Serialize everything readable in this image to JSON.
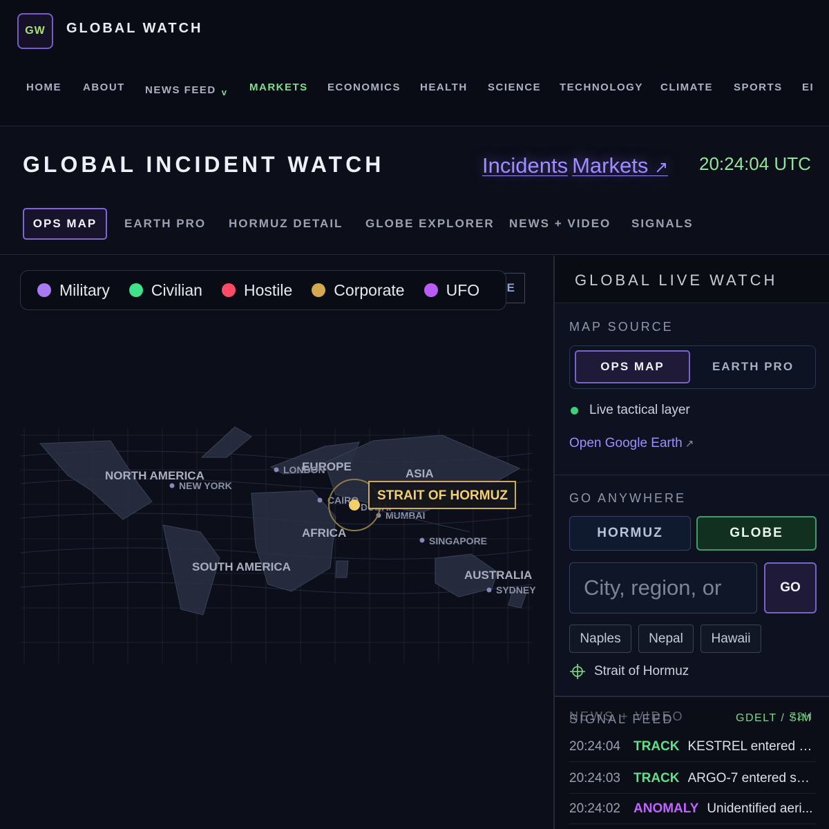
{
  "header": {
    "logo": "GW",
    "brand": "GLOBAL WATCH",
    "nav": [
      {
        "label": "HOME"
      },
      {
        "label": "ABOUT"
      },
      {
        "label": "NEWS FEED",
        "chevron": "v"
      },
      {
        "label": "MARKETS",
        "active": true
      },
      {
        "label": "ECONOMICS"
      },
      {
        "label": "HEALTH"
      },
      {
        "label": "SCIENCE"
      },
      {
        "label": "TECHNOLOGY"
      },
      {
        "label": "CLIMATE"
      },
      {
        "label": "SPORTS"
      },
      {
        "label": "EI"
      }
    ]
  },
  "titlebar": {
    "title": "GLOBAL INCIDENT WATCH",
    "link_incidents": "Incidents",
    "link_markets": "Markets",
    "link_ext": "↗",
    "clock": "20:24:04 UTC",
    "tabs": [
      "OPS MAP",
      "EARTH PRO",
      "HORMUZ DETAIL",
      "GLOBE EXPLORER",
      "NEWS + VIDEO",
      "SIGNALS"
    ]
  },
  "map": {
    "legend": [
      {
        "label": "Military",
        "color": "#a77bf3"
      },
      {
        "label": "Civilian",
        "color": "#3ee28a"
      },
      {
        "label": "Hostile",
        "color": "#ff4b66"
      },
      {
        "label": "Corporate",
        "color": "#d4a84e"
      },
      {
        "label": "UFO",
        "color": "#b95cf5"
      }
    ],
    "ghost_button": "E",
    "regions": [
      "NORTH AMERICA",
      "EUROPE",
      "ASIA",
      "AFRICA",
      "SOUTH AMERICA",
      "AUSTRALIA"
    ],
    "cities": [
      "NEW YORK",
      "LONDON",
      "CAIRO",
      "DUBAI",
      "MUMBAI",
      "SINGAPORE",
      "SYDNEY"
    ],
    "focus_label": "STRAIT OF HORMUZ"
  },
  "panel": {
    "title": "GLOBAL LIVE WATCH",
    "map_source": {
      "label": "MAP SOURCE",
      "on": "OPS MAP",
      "off": "EARTH PRO",
      "status": "Live tactical layer",
      "link": "Open Google Earth",
      "link_ext": "↗"
    },
    "go_anywhere": {
      "label": "GO ANYWHERE",
      "btn_hormuz": "HORMUZ",
      "btn_globe": "GLOBE",
      "placeholder": "City, region, or",
      "go": "GO",
      "chips": [
        "Naples",
        "Nepal",
        "Hawaii"
      ],
      "target": "Strait of Hormuz"
    },
    "feed": {
      "label_back": "NEWS + VIDEO",
      "label_front": "SIGNAL FEED",
      "source_back": "72H",
      "source_front": "GDELT / SIM",
      "rows": [
        {
          "time": "20:24:04",
          "kind": "TRACK",
          "msg": "KESTREL entered s..."
        },
        {
          "time": "20:24:03",
          "kind": "TRACK",
          "msg": "ARGO-7 entered shi..."
        },
        {
          "time": "20:24:02",
          "kind": "ANOMALY",
          "msg": "Unidentified aeri..."
        }
      ]
    }
  }
}
